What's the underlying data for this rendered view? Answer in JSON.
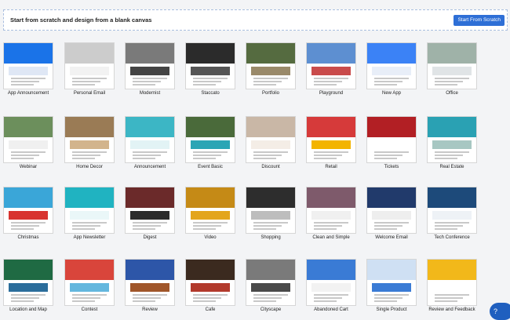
{
  "banner": {
    "text": "Start from scratch and design from a blank canvas",
    "button_label": "Start From Scratch"
  },
  "templates": [
    {
      "label": "App Announcement",
      "colors": [
        "#1a73e8",
        "#dfe7f5"
      ]
    },
    {
      "label": "Personal Email",
      "colors": [
        "#cccccc",
        "#f2f2f2"
      ]
    },
    {
      "label": "Modernist",
      "colors": [
        "#7a7a7a",
        "#444444"
      ]
    },
    {
      "label": "Staccato",
      "colors": [
        "#2b2b2b",
        "#555555"
      ]
    },
    {
      "label": "Portfolio",
      "colors": [
        "#556b40",
        "#9a8a6a"
      ]
    },
    {
      "label": "Playground",
      "colors": [
        "#5d8fd1",
        "#c94b4b"
      ]
    },
    {
      "label": "New App",
      "colors": [
        "#3b82f6",
        "#e8eef8"
      ]
    },
    {
      "label": "Office",
      "colors": [
        "#9fb2a8",
        "#e0e4e6"
      ]
    },
    {
      "label": "Webinar",
      "colors": [
        "#6c8f5c",
        "#f0f0f0"
      ]
    },
    {
      "label": "Home Decor",
      "colors": [
        "#9a7b55",
        "#d2b48c"
      ]
    },
    {
      "label": "Announcement",
      "colors": [
        "#3cb6c5",
        "#e2f3f5"
      ]
    },
    {
      "label": "Event Basic",
      "colors": [
        "#4a6a3a",
        "#2ba5b5"
      ]
    },
    {
      "label": "Discount",
      "colors": [
        "#c9b7a6",
        "#f4ede6"
      ]
    },
    {
      "label": "Retail",
      "colors": [
        "#d63a3a",
        "#f3b400"
      ]
    },
    {
      "label": "Tickets",
      "colors": [
        "#b21f24",
        "#ffffff"
      ]
    },
    {
      "label": "Real Estate",
      "colors": [
        "#2aa1b3",
        "#a7c7c2"
      ]
    },
    {
      "label": "Christmas",
      "colors": [
        "#3aa6d8",
        "#d8332f"
      ]
    },
    {
      "label": "App Newsletter",
      "colors": [
        "#20b3c1",
        "#eaf7f8"
      ]
    },
    {
      "label": "Digest",
      "colors": [
        "#6b2a2a",
        "#2b2b2b"
      ]
    },
    {
      "label": "Video",
      "colors": [
        "#c58a16",
        "#e3a51c"
      ]
    },
    {
      "label": "Shopping",
      "colors": [
        "#2d2d2d",
        "#bdbdbd"
      ]
    },
    {
      "label": "Clean and Simple",
      "colors": [
        "#7e5a6b",
        "#f0f0f0"
      ]
    },
    {
      "label": "Welcome Email",
      "colors": [
        "#213a6b",
        "#eeeeee"
      ]
    },
    {
      "label": "Tech Conference",
      "colors": [
        "#1d4a7a",
        "#eef2f6"
      ]
    },
    {
      "label": "Location and Map",
      "colors": [
        "#1f6a43",
        "#2b6d9b"
      ]
    },
    {
      "label": "Contest",
      "colors": [
        "#d9453b",
        "#64b7de"
      ]
    },
    {
      "label": "Review",
      "colors": [
        "#2d56a8",
        "#a0562a"
      ]
    },
    {
      "label": "Cafe",
      "colors": [
        "#3b2a1f",
        "#b23a2c"
      ]
    },
    {
      "label": "Cityscape",
      "colors": [
        "#7a7a7a",
        "#4a4a4a"
      ]
    },
    {
      "label": "Abandoned Cart",
      "colors": [
        "#3a7bd5",
        "#f2f2f2"
      ]
    },
    {
      "label": "Single Product",
      "colors": [
        "#cfe0f3",
        "#3a7bd5"
      ]
    },
    {
      "label": "Review and Feedback",
      "colors": [
        "#f2b81a",
        "#ffffff"
      ]
    }
  ],
  "help": {
    "icon": "question-icon"
  }
}
